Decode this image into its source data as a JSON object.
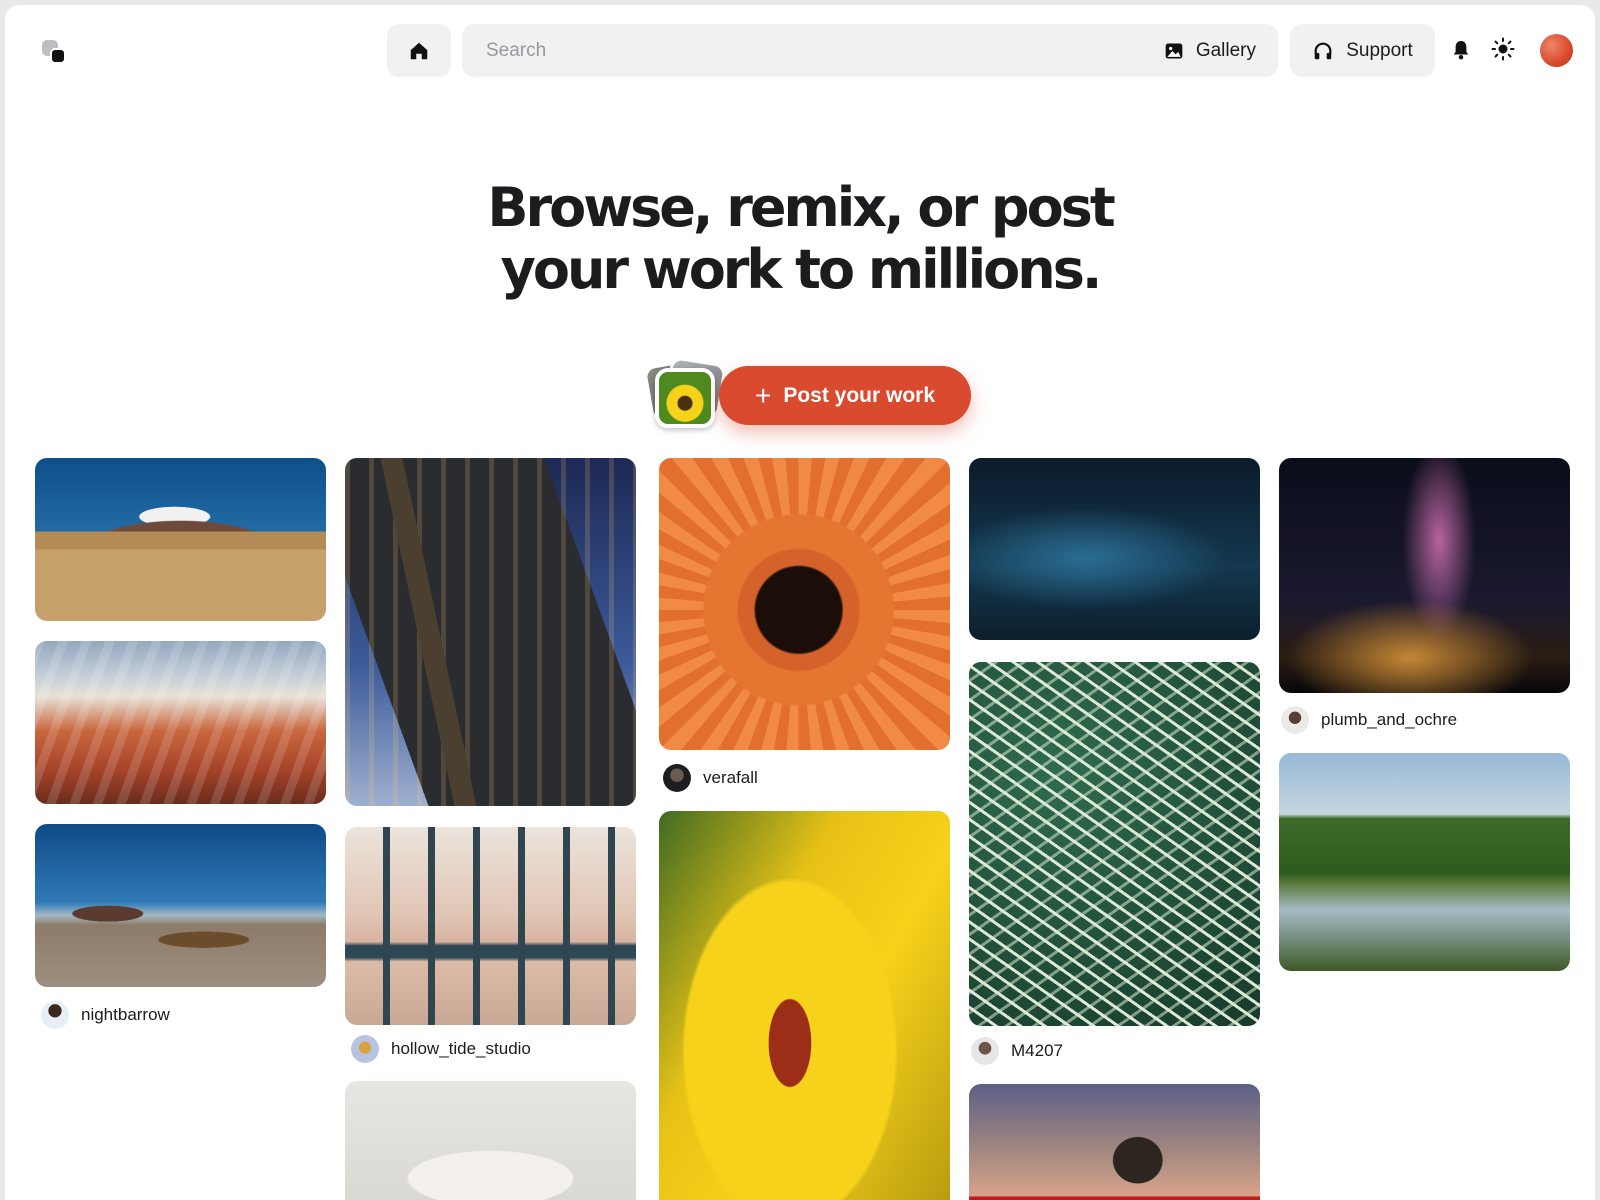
{
  "topbar": {
    "search_placeholder": "Search",
    "gallery_label": "Gallery",
    "support_label": "Support"
  },
  "hero": {
    "line1": "Browse, remix, or post",
    "line2": "your work to millions."
  },
  "cta": {
    "label": "Post your work"
  },
  "feed": {
    "captions": {
      "nightbarrow": "nightbarrow",
      "hollow_tide_studio": "hollow_tide_studio",
      "verafall": "verafall",
      "m4207": "M4207",
      "plumb_and_ochre": "plumb_and_ochre"
    }
  },
  "colors": {
    "accent": "#d94a2f",
    "chip_bg": "#f1f1f2",
    "text": "#1c1c1e"
  }
}
